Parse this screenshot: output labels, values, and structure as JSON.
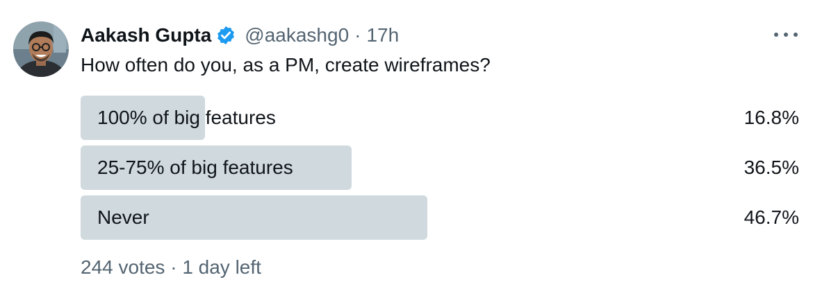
{
  "tweet": {
    "author_name": "Aakash Gupta",
    "handle": "@aakashg0",
    "separator": "·",
    "time": "17h",
    "question": "How often do you, as a PM, create wireframes?",
    "verified_color": "#1d9bf0"
  },
  "poll": {
    "options": [
      {
        "label": "100% of big features",
        "percent_text": "16.8%",
        "percent": 16.8
      },
      {
        "label": "25-75% of big features",
        "percent_text": "36.5%",
        "percent": 36.5
      },
      {
        "label": "Never",
        "percent_text": "46.7%",
        "percent": 46.7
      }
    ],
    "votes": "244 votes",
    "separator": "·",
    "time_left": "1 day left"
  },
  "icons": {
    "verified": "verified-badge-icon",
    "more": "more-options-icon"
  }
}
